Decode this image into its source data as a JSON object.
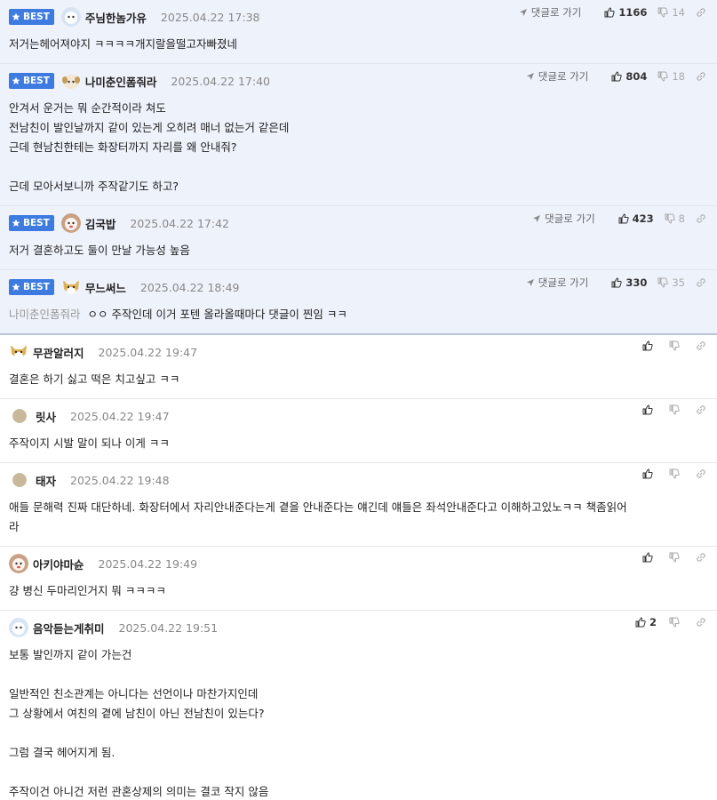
{
  "colors": {
    "accent": "#3e7be0",
    "best_bg": "#eef2fb"
  },
  "labels": {
    "best": "BEST",
    "goto_reply": "댓글로 가기"
  },
  "icons": {
    "best": "star-icon",
    "goto": "arrow-icon",
    "up": "thumbs-up-icon",
    "down": "thumbs-down-icon",
    "link": "link-icon"
  },
  "best_comments": [
    {
      "nick": "주님한놈가유",
      "date": "2025.04.22 17:38",
      "up": "1166",
      "down": "14",
      "lines": [
        "저거는헤어져야지 ㅋㅋㅋㅋ개지랄을떨고자빠졌네"
      ]
    },
    {
      "nick": "나미춘인폼줘라",
      "date": "2025.04.22 17:40",
      "up": "804",
      "down": "18",
      "lines": [
        "안겨서 운거는 뭐 순간적이라 쳐도",
        "전남친이 발인날까지 같이 있는게 오히려 매너 없는거 같은데",
        "근데 현남친한테는 화장터까지 자리를 왜 안내줘?",
        "",
        "근데 모아서보니까 주작같기도 하고?"
      ]
    },
    {
      "nick": "김국밥",
      "date": "2025.04.22 17:42",
      "up": "423",
      "down": "8",
      "lines": [
        "저거 결혼하고도 둘이 만날 가능성 높음"
      ]
    },
    {
      "nick": "무느써느",
      "date": "2025.04.22 18:49",
      "up": "330",
      "down": "35",
      "reply_to": "나미춘인폼줘라",
      "lines": [
        "ㅇㅇ 주작인데 이거 포텐 올라올때마다 댓글이 찐임 ㅋㅋ"
      ]
    }
  ],
  "comments": [
    {
      "nick": "무관알러지",
      "date": "2025.04.22 19:47",
      "up": "",
      "lines": [
        "결혼은 하기 싫고 떡은 치고싶고 ㅋㅋ"
      ]
    },
    {
      "nick": "릿사",
      "date": "2025.04.22 19:47",
      "up": "",
      "lines": [
        "주작이지 시발 말이 되나 이게 ㅋㅋ"
      ]
    },
    {
      "nick": "태자",
      "date": "2025.04.22 19:48",
      "up": "",
      "lines": [
        "애들 문해력 진짜 대단하네. 화장터에서 자리안내준다는게 곁을 안내준다는 얘긴데 얘들은 좌석안내준다고 이해하고있노ㅋㅋ 책좀읽어",
        "라"
      ]
    },
    {
      "nick": "아키야마슌",
      "date": "2025.04.22 19:49",
      "up": "",
      "lines": [
        "걍 병신 두마리인거지 뭐 ㅋㅋㅋㅋ"
      ]
    },
    {
      "nick": "음악듣는게취미",
      "date": "2025.04.22 19:51",
      "up": "2",
      "lines": [
        "보통 발인까지 같이 가는건",
        "",
        "일반적인 친소관계는 아니다는 선언이나 마찬가지인데",
        "그 상황에서 여친의 곁에 남친이 아닌 전남친이 있는다?",
        "",
        "그럼 결국 헤어지게 됨.",
        "",
        "주작이건 아니건 저런 관혼상제의 의미는 결코 작지 않음"
      ]
    }
  ]
}
